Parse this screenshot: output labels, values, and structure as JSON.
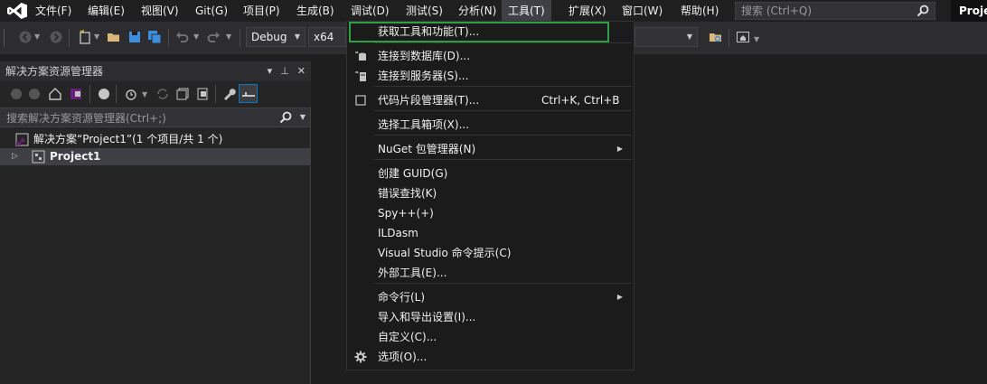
{
  "menubar": {
    "items": [
      "文件(F)",
      "编辑(E)",
      "视图(V)",
      "Git(G)",
      "项目(P)",
      "生成(B)",
      "调试(D)",
      "测试(S)",
      "分析(N)",
      "工具(T)",
      "扩展(X)",
      "窗口(W)",
      "帮助(H)"
    ],
    "active_item": "工具(T)",
    "search_placeholder": "搜索 (Ctrl+Q)",
    "project_badge": "Proje"
  },
  "toolbar": {
    "configuration": "Debug",
    "platform": "x64"
  },
  "solution_explorer": {
    "title": "解决方案资源管理器",
    "title_actions": [
      "▾",
      "⊥",
      "✕"
    ],
    "search_placeholder": "搜索解决方案资源管理器(Ctrl+;)",
    "solution_label": "解决方案“Project1”(1 个项目/共 1 个)",
    "project_label": "Project1"
  },
  "tools_menu": {
    "items": [
      {
        "label": "获取工具和功能(T)...",
        "icon": "",
        "shortcut": "",
        "submenu": false
      },
      {
        "label": "连接到数据库(D)...",
        "icon": "database-connect-icon",
        "shortcut": "",
        "submenu": false
      },
      {
        "label": "连接到服务器(S)...",
        "icon": "server-connect-icon",
        "shortcut": "",
        "submenu": false
      },
      {
        "label": "代码片段管理器(T)...",
        "icon": "checkbox-icon",
        "shortcut": "Ctrl+K, Ctrl+B",
        "submenu": false
      },
      {
        "label": "选择工具箱项(X)...",
        "icon": "",
        "shortcut": "",
        "submenu": false
      },
      {
        "label": "NuGet 包管理器(N)",
        "icon": "",
        "shortcut": "",
        "submenu": true
      },
      {
        "label": "创建 GUID(G)",
        "icon": "",
        "shortcut": "",
        "submenu": false
      },
      {
        "label": "错误查找(K)",
        "icon": "",
        "shortcut": "",
        "submenu": false
      },
      {
        "label": "Spy++(+)",
        "icon": "",
        "shortcut": "",
        "submenu": false
      },
      {
        "label": "ILDasm",
        "icon": "",
        "shortcut": "",
        "submenu": false
      },
      {
        "label": "Visual Studio 命令提示(C)",
        "icon": "",
        "shortcut": "",
        "submenu": false
      },
      {
        "label": "外部工具(E)...",
        "icon": "",
        "shortcut": "",
        "submenu": false
      },
      {
        "label": "命令行(L)",
        "icon": "",
        "shortcut": "",
        "submenu": true
      },
      {
        "label": "导入和导出设置(I)...",
        "icon": "",
        "shortcut": "",
        "submenu": false
      },
      {
        "label": "自定义(C)...",
        "icon": "",
        "shortcut": "",
        "submenu": false
      },
      {
        "label": "选项(O)...",
        "icon": "gear-icon",
        "shortcut": "",
        "submenu": false
      }
    ],
    "highlighted_item": "获取工具和功能(T)...",
    "highlight_color": "#2ea043"
  },
  "colors": {
    "background": "#1e1e1e",
    "menu_background": "#1b1b1c",
    "accent": "#68217a"
  }
}
